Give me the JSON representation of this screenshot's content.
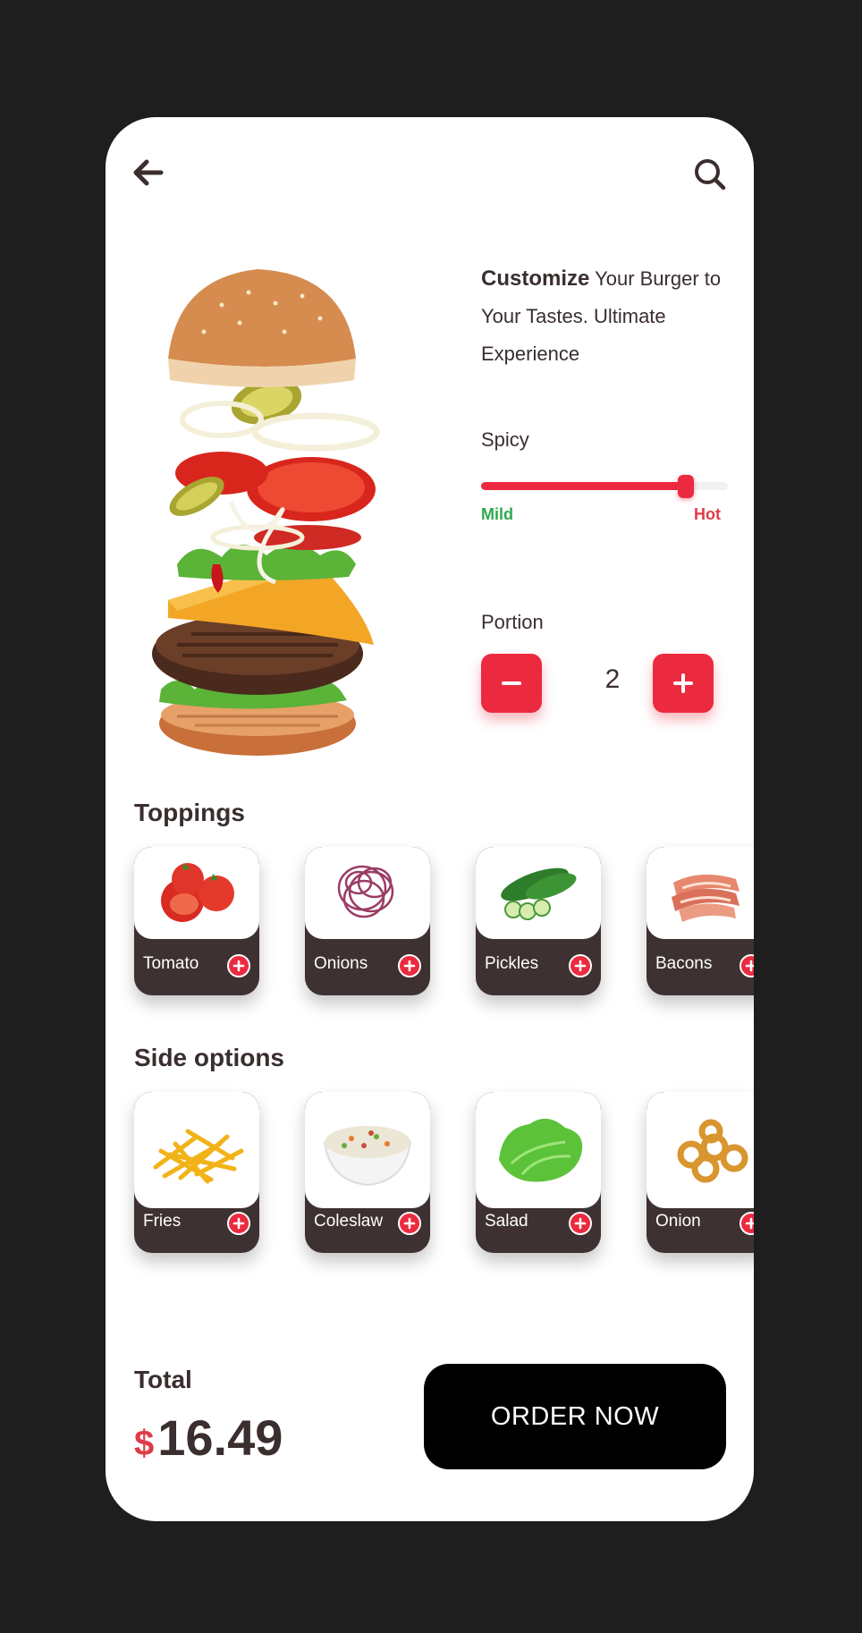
{
  "header": {
    "back_icon": "arrow-left-icon",
    "search_icon": "search-icon"
  },
  "hero": {
    "headline_bold": "Customize",
    "headline_rest": " Your Burger to Your Tastes. Ultimate Experience",
    "image": "exploded-burger"
  },
  "spicy": {
    "label": "Spicy",
    "min_label": "Mild",
    "max_label": "Hot",
    "level": 0.83
  },
  "portion": {
    "label": "Portion",
    "value": "2"
  },
  "toppings": {
    "title": "Toppings",
    "items": [
      {
        "label": "Tomato",
        "icon": "tomato"
      },
      {
        "label": "Onions",
        "icon": "onion-rings"
      },
      {
        "label": "Pickles",
        "icon": "cucumber"
      },
      {
        "label": "Bacons",
        "icon": "bacon"
      }
    ]
  },
  "sides": {
    "title": "Side options",
    "items": [
      {
        "label": "Fries",
        "icon": "fries"
      },
      {
        "label": "Coleslaw",
        "icon": "coleslaw"
      },
      {
        "label": "Salad",
        "icon": "lettuce"
      },
      {
        "label": "Onion",
        "icon": "onion-rings-fried"
      }
    ]
  },
  "footer": {
    "total_label": "Total",
    "currency": "$",
    "amount": "16.49",
    "order_label": "ORDER NOW"
  },
  "colors": {
    "accent": "#ec2a3f",
    "mild": "#2fa84f",
    "tile_bg": "#3d3131",
    "text": "#3a2e2e",
    "page_bg": "#1e1e1e"
  }
}
